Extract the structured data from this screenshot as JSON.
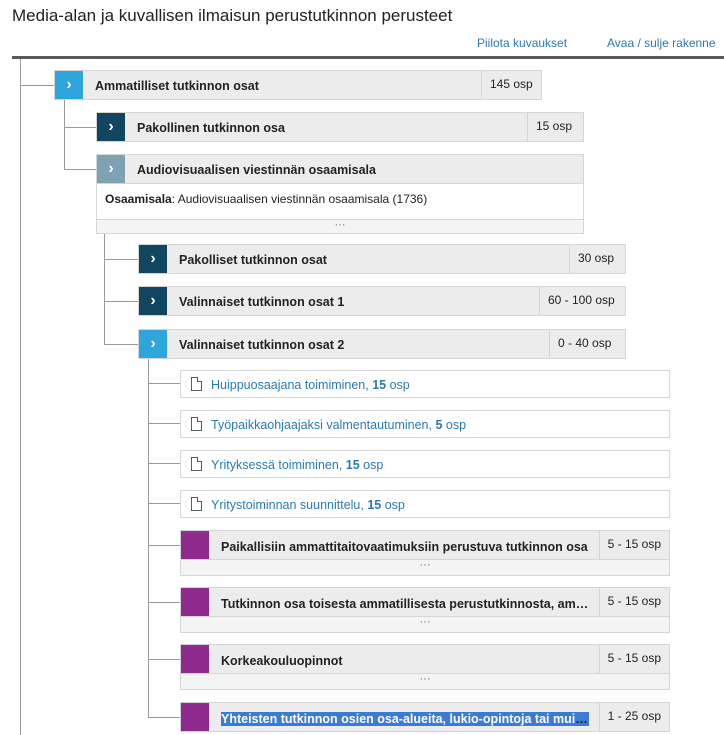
{
  "page": {
    "title": "Media-alan ja kuvallisen ilmaisun perustutkinnon perusteet",
    "hide_descriptions": "Piilota kuvaukset",
    "toggle_structure": "Avaa / sulje rakenne"
  },
  "tree": {
    "root": {
      "label": "Ammatilliset tutkinnon osat",
      "osp": "145 osp"
    },
    "mandatory": {
      "label": "Pakollinen tutkinnon osa",
      "osp": "15 osp"
    },
    "audiovisual": {
      "label": "Audiovisuaalisen viestinnän osaamisala",
      "field_key": "Osaamisala",
      "field_value": ": Audiovisuaalisen viestinnän osaamisala (1736)",
      "dots": "···"
    },
    "children": [
      {
        "label": "Pakolliset tutkinnon osat",
        "osp": "30 osp"
      },
      {
        "label": "Valinnaiset tutkinnon osat 1",
        "osp": "60 - 100 osp"
      },
      {
        "label": "Valinnaiset tutkinnon osat 2",
        "osp": "0 - 40 osp"
      }
    ],
    "leaves": [
      {
        "name": "Huippuosaajana toimiminen, ",
        "osp_num": "15",
        "osp_unit": " osp"
      },
      {
        "name": "Työpaikkaohjaajaksi valmentautuminen, ",
        "osp_num": "5",
        "osp_unit": " osp"
      },
      {
        "name": "Yrityksessä toimiminen, ",
        "osp_num": "15",
        "osp_unit": " osp"
      },
      {
        "name": "Yritystoiminnan suunnittelu, ",
        "osp_num": "15",
        "osp_unit": " osp"
      }
    ],
    "groups": [
      {
        "label": "Paikallisiin ammattitaitovaatimuksiin perustuva tutkinnon osa",
        "osp": "5 - 15 osp",
        "dots": "···"
      },
      {
        "label": "Tutkinnon osa toisesta ammatillisesta perustutkinnosta, ammattitutkinnosta tai erikoisammattitutkinnosta",
        "osp": "5 - 15 osp",
        "dots": "···"
      },
      {
        "label": "Korkeakouluopinnot",
        "osp": "5 - 15 osp",
        "dots": "···"
      },
      {
        "label": "Yhteisten tutkinnon osien osa-alueita, lukio-opintoja tai muita jatko-opintovalmiuksia tukevia opintoja",
        "osp": "1 - 25 osp"
      }
    ]
  },
  "colors": {
    "chevron_dark": "#114660",
    "chevron_light": "#2ea6dd",
    "chevron_grey": "#7ea2b4",
    "group_marker": "#8e2a8e",
    "link": "#2a7ab0"
  }
}
